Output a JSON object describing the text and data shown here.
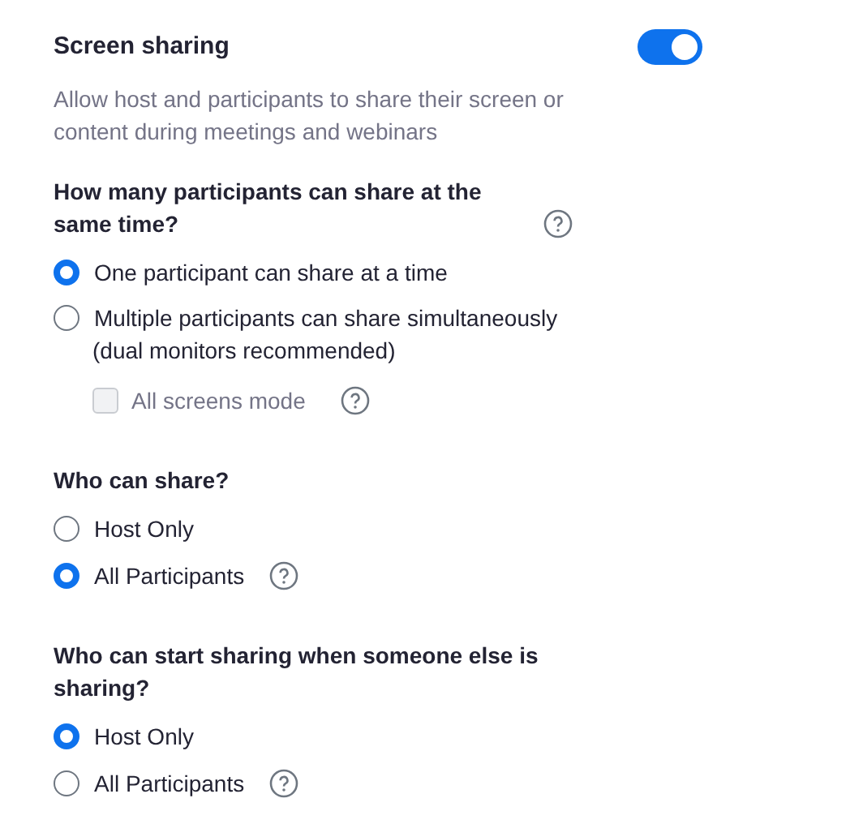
{
  "setting": {
    "title": "Screen sharing",
    "on": true,
    "description": "Allow host and participants to share their screen or content during meetings and webinars"
  },
  "groups": [
    {
      "question": "How many participants can share at the same time?",
      "help": true,
      "options": [
        {
          "label": "One participant can share at a time",
          "selected": true,
          "help": false
        },
        {
          "label": "Multiple participants can share simultaneously",
          "note": "(dual monitors recommended)",
          "selected": false,
          "help": false,
          "suboption": {
            "label": "All screens mode",
            "checked": false,
            "disabled": true,
            "help": true
          }
        }
      ]
    },
    {
      "question": "Who can share?",
      "help": false,
      "options": [
        {
          "label": "Host Only",
          "selected": false,
          "help": false
        },
        {
          "label": "All Participants",
          "selected": true,
          "help": true
        }
      ]
    },
    {
      "question": "Who can start sharing when someone else is sharing?",
      "help": false,
      "options": [
        {
          "label": "Host Only",
          "selected": true,
          "help": false
        },
        {
          "label": "All Participants",
          "selected": false,
          "help": true
        }
      ]
    }
  ]
}
